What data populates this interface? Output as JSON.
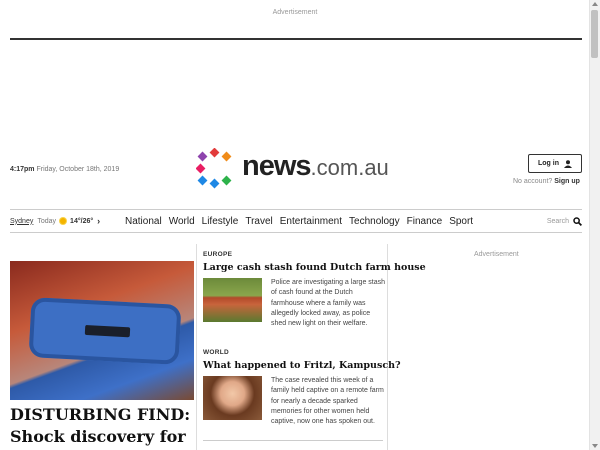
{
  "ads": {
    "top_label": "Advertisement",
    "side_label": "Advertisement"
  },
  "header": {
    "time": "4:17pm",
    "date": "Friday, October 18th, 2019",
    "logo_main": "news",
    "logo_suffix": ".com.au",
    "login_label": "Log in",
    "no_account": "No account?",
    "signup_label": "Sign up"
  },
  "weather": {
    "city": "Sydney",
    "day": "Today",
    "temps": "14°/26°"
  },
  "nav": {
    "links": [
      "National",
      "World",
      "Lifestyle",
      "Travel",
      "Entertainment",
      "Technology",
      "Finance",
      "Sport"
    ],
    "search_label": "Search"
  },
  "hero": {
    "title": "DISTURBING FIND: Shock discovery for"
  },
  "stories": [
    {
      "category": "EUROPE",
      "headline": "Large cash stash found Dutch farm house",
      "blurb": "Police are investigating a large stash of cash found at the Dutch farmhouse where a family was allegedly locked away, as police shed new light on their welfare."
    },
    {
      "category": "WORLD",
      "headline": "What happened to Fritzl, Kampusch?",
      "blurb": "The case revealed this week of a family held captive on a remote farm for nearly a decade sparked memories for other women held captive, now one has spoken out."
    }
  ],
  "colors": {
    "accent": "#222222",
    "logo_dots": [
      "#e23b3b",
      "#f08c1a",
      "#2db24a",
      "#1e88e5",
      "#8e44ad",
      "#e91e63"
    ]
  }
}
